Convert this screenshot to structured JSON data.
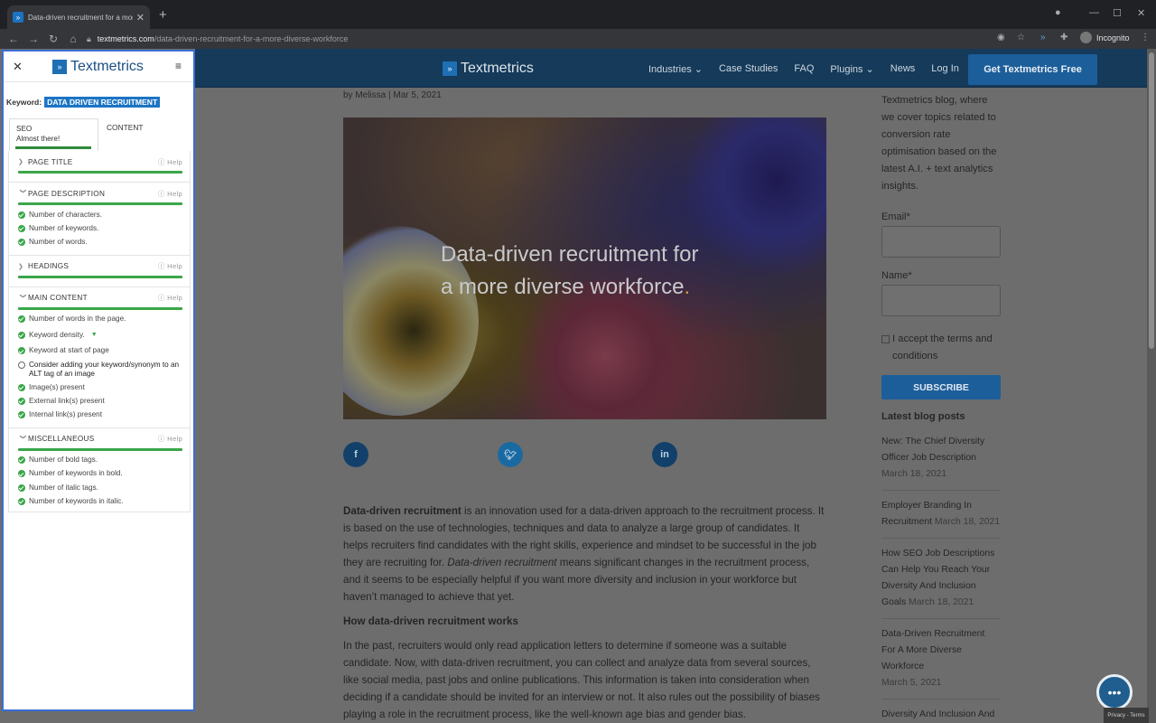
{
  "browser": {
    "tab_title": "Data-driven recruitment for a more",
    "url_domain": "textmetrics.com",
    "url_path": "/data-driven-recruitment-for-a-more-diverse-workforce",
    "incognito_label": "Incognito"
  },
  "site": {
    "logo_text": "Textmetrics",
    "nav": [
      "Industries",
      "Case Studies",
      "FAQ",
      "Plugins",
      "News",
      "Log In"
    ],
    "cta_label": "Get Textmetrics Free"
  },
  "article": {
    "byline": "by Melissa | Mar 5, 2021",
    "hero_title_line1": "Data-driven recruitment for",
    "hero_title_line2": "a more diverse workforce",
    "hero_title_dot": ".",
    "p1_bold": "Data-driven recruitment",
    "p1_a": " is an innovation used for a data-driven approach to the recruitment process. It is based on the use of technologies, techniques and data to analyze a large group of candidates. It helps recruiters find candidates with the right skills, experience and mindset to be successful in the job they are recruiting for. ",
    "p1_italic": "Data-driven recruitment",
    "p1_b": " means significant changes in the recruitment process, and it seems to be especially helpful if you want more diversity and inclusion in your workforce but haven’t managed to achieve that yet.",
    "heading2": "How data-driven recruitment works",
    "p2": "In the past, recruiters would only read application letters to determine if someone was a suitable candidate. Now, with data-driven recruitment, you can collect and analyze data from several sources, like social media, past jobs and online publications. This information is taken into consideration when deciding if a candidate should be invited for an interview or not. It also rules out the possibility of biases playing a role in the recruitment process, like the well-known age bias and gender bias."
  },
  "sidebar": {
    "intro": "Textmetrics blog, where we cover topics related to conversion rate optimisation based on the latest A.I. + text analytics insights.",
    "email_label": "Email*",
    "name_label": "Name*",
    "terms_label": "I accept the terms and conditions",
    "subscribe_label": "SUBSCRIBE",
    "latest_heading": "Latest blog posts",
    "posts": [
      {
        "title": "New: The Chief Diversity Officer Job Description",
        "date": "March 18, 2021"
      },
      {
        "title": "Employer Branding In Recruitment",
        "date": "March 18, 2021"
      },
      {
        "title": "How SEO Job Descriptions Can Help You Reach Your Diversity And Inclusion Goals",
        "date": "March 18, 2021"
      },
      {
        "title": "Data-Driven Recruitment For A More Diverse Workforce",
        "date": "March 5, 2021"
      },
      {
        "title": "Diversity And Inclusion And An Augmented Writing",
        "date": ""
      }
    ]
  },
  "panel": {
    "logo_text": "Textmetrics",
    "keyword_label": "Keyword:",
    "keyword_value": "DATA DRIVEN RECRUITMENT",
    "tab_seo": "SEO",
    "tab_seo_status": "Almost there!",
    "tab_content": "CONTENT",
    "help_label": "Help",
    "sections": {
      "page_title": "PAGE TITLE",
      "page_description": "PAGE DESCRIPTION",
      "headings": "HEADINGS",
      "main_content": "MAIN CONTENT",
      "miscellaneous": "MISCELLANEOUS"
    },
    "page_description_items": [
      "Number of characters.",
      "Number of keywords.",
      "Number of words."
    ],
    "main_content_items": [
      "Number of words in the page.",
      "Keyword density.",
      "Keyword at start of page",
      "Consider adding your keyword/synonym to an ALT tag of an image",
      "Image(s) present",
      "External link(s) present",
      "Internal link(s) present"
    ],
    "misc_items": [
      "Number of bold tags.",
      "Number of keywords in bold.",
      "Number of italic tags.",
      "Number of keywords in italic."
    ]
  },
  "recaptcha_text": "Privacy - Terms",
  "colors": {
    "accent": "#1c75c4",
    "success": "#3aa64a",
    "panel_border": "#3b6ed6",
    "header": "#153a5a"
  }
}
